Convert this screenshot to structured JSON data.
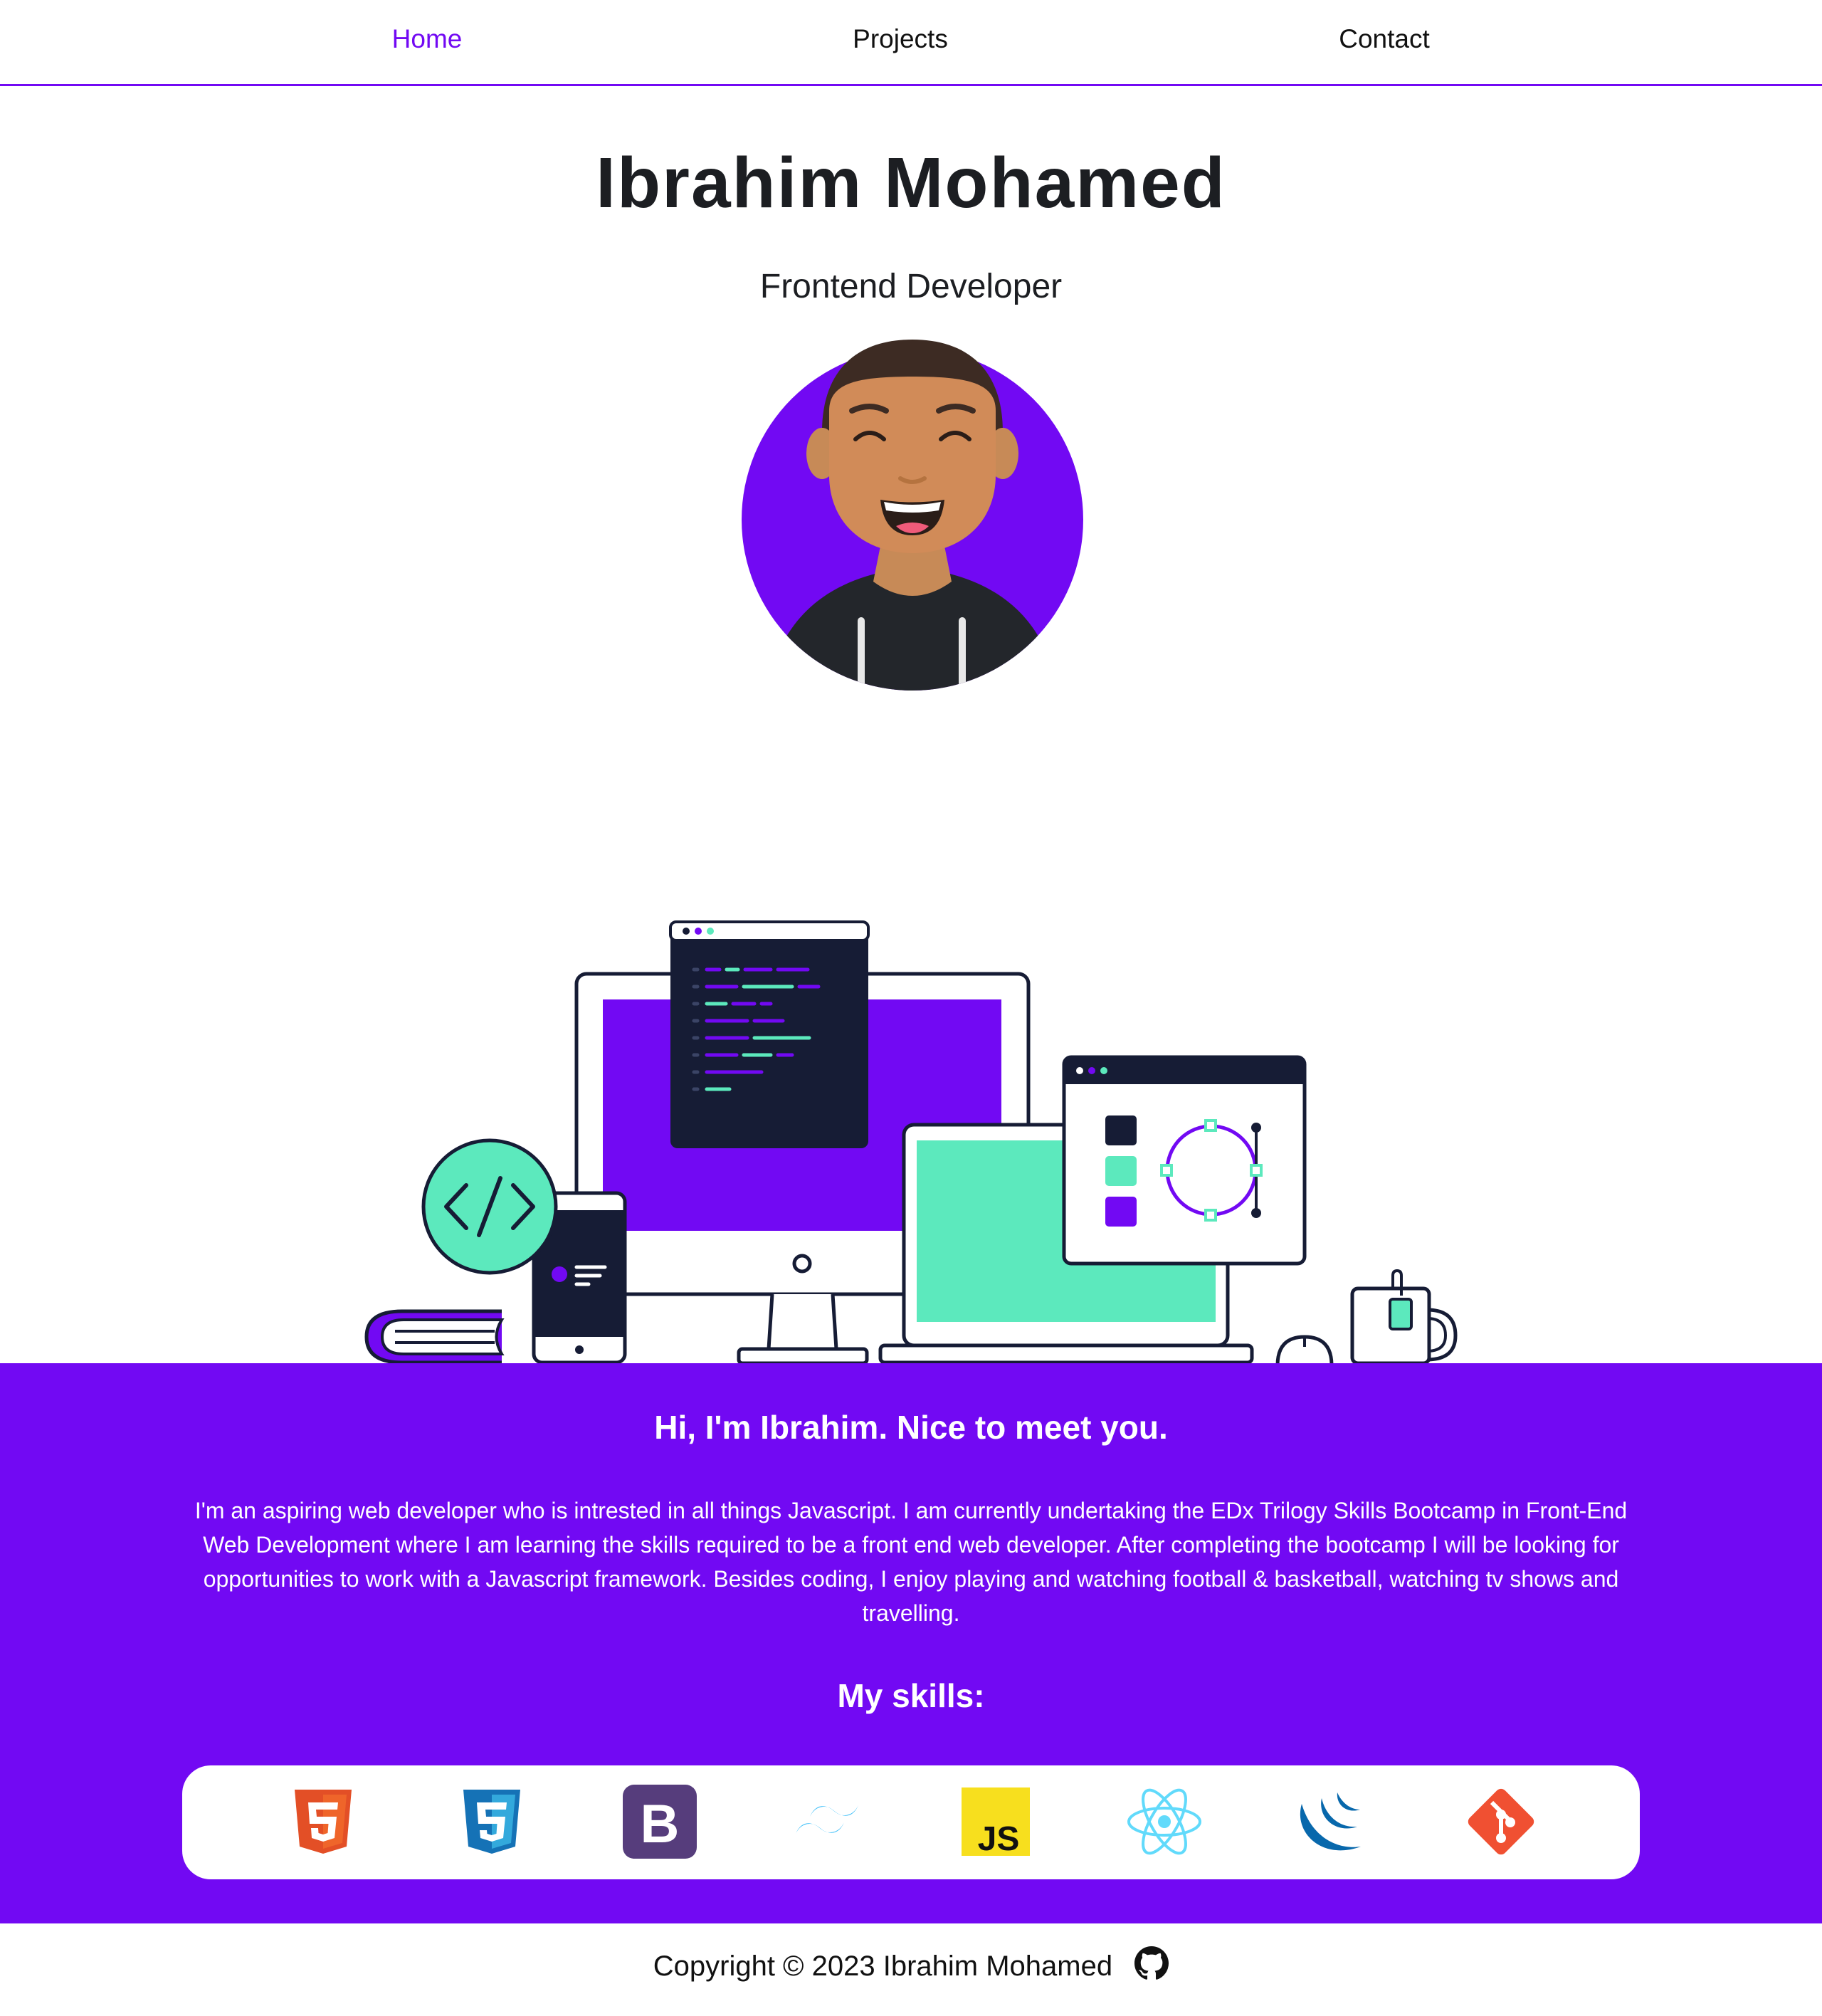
{
  "nav": {
    "items": [
      {
        "label": "Home",
        "active": true
      },
      {
        "label": "Projects",
        "active": false
      },
      {
        "label": "Contact",
        "active": false
      }
    ]
  },
  "hero": {
    "name": "Ibrahim Mohamed",
    "role": "Frontend Developer"
  },
  "about": {
    "heading": "Hi, I'm Ibrahim. Nice to meet you.",
    "text": "I'm an aspiring web developer who is intrested in all things Javascript. I am currently undertaking the EDx Trilogy Skills Bootcamp in Front-End Web Development where I am learning the skills required to be a front end web developer. After completing the bootcamp I will be looking for opportunities to work with a Javascript framework. Besides coding, I enjoy playing and watching football & basketball, watching tv shows and travelling.",
    "skills_heading": "My skills:",
    "skills": [
      {
        "icon": "html5-icon"
      },
      {
        "icon": "css3-icon"
      },
      {
        "icon": "bootstrap-icon"
      },
      {
        "icon": "tailwind-icon"
      },
      {
        "icon": "javascript-icon"
      },
      {
        "icon": "react-icon"
      },
      {
        "icon": "jquery-icon"
      },
      {
        "icon": "git-icon"
      }
    ]
  },
  "footer": {
    "copyright": "Copyright © 2023 Ibrahim Mohamed",
    "icon": "github-icon"
  },
  "colors": {
    "accent": "#7209f3",
    "mint": "#5ce9bd",
    "navy": "#161c35"
  }
}
